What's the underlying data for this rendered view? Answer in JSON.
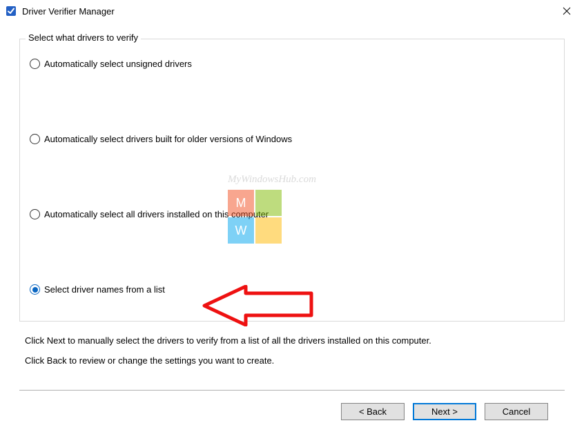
{
  "window": {
    "title": "Driver Verifier Manager"
  },
  "group": {
    "legend": "Select what drivers to verify",
    "options": [
      {
        "label": "Automatically select unsigned drivers",
        "selected": false
      },
      {
        "label": "Automatically select drivers built for older versions of Windows",
        "selected": false
      },
      {
        "label": "Automatically select all drivers installed on this computer",
        "selected": false
      },
      {
        "label": "Select driver names from a list",
        "selected": true
      }
    ]
  },
  "help": {
    "line1": "Click Next to manually select the drivers to verify from a list of all the drivers installed on this computer.",
    "line2": "Click Back to review or change the settings you want to create."
  },
  "buttons": {
    "back": "< Back",
    "next": "Next >",
    "cancel": "Cancel"
  },
  "watermark": {
    "text": "MyWindowsHub.com",
    "letters": {
      "m": "M",
      "w": "W"
    }
  }
}
